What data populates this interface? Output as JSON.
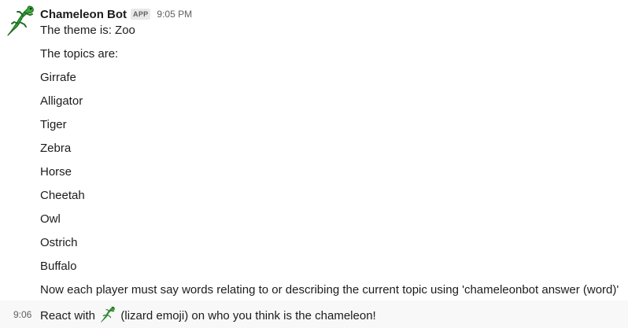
{
  "message": {
    "author": "Chameleon Bot",
    "badge": "APP",
    "time": "9:05 PM",
    "avatar_icon": "lizard-icon",
    "lines": [
      "The theme is: Zoo",
      "The topics are:",
      "Girrafe",
      "Alligator",
      "Tiger",
      "Zebra",
      "Horse",
      "Cheetah",
      "Owl",
      "Ostrich",
      "Buffalo",
      "Now each player must say words relating to or describing the current topic using 'chameleonbot answer (word)'"
    ]
  },
  "followup": {
    "time": "9:06",
    "text_before": "React with",
    "emoji_icon": "lizard-icon",
    "text_after": "(lizard emoji) on who you think is the chameleon!"
  },
  "colors": {
    "lizard_body": "#3aa83a",
    "lizard_dark": "#1e6e22",
    "hover_row": "#f8f8f8",
    "muted_text": "#616061"
  }
}
